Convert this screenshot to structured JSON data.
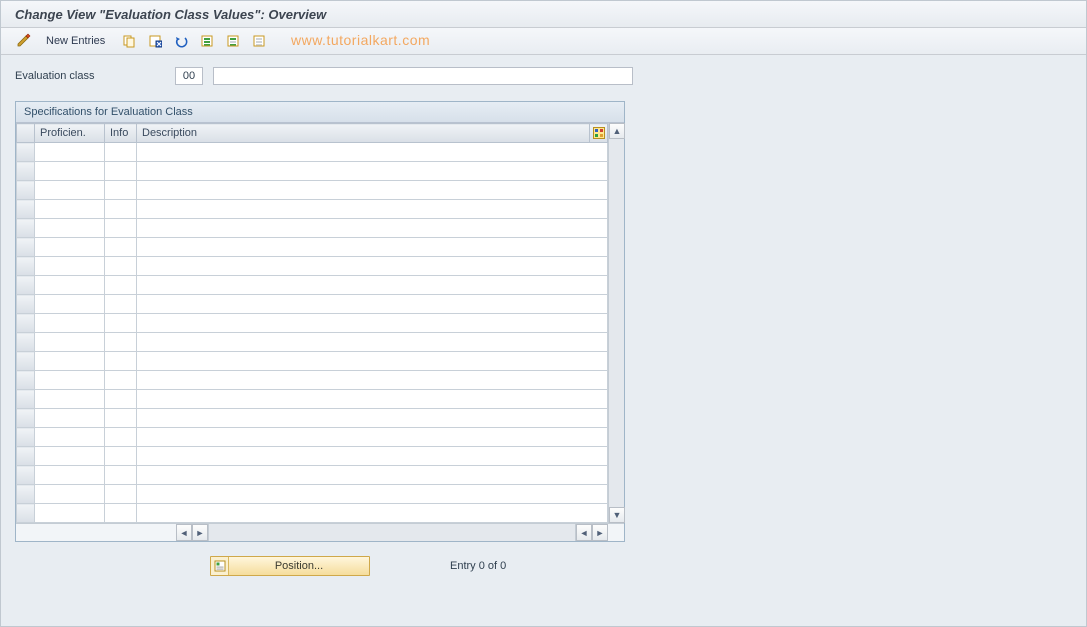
{
  "title": "Change View \"Evaluation Class Values\": Overview",
  "toolbar": {
    "new_entries_label": "New Entries"
  },
  "watermark": "www.tutorialkart.com",
  "field": {
    "label": "Evaluation class",
    "value": "00",
    "desc": ""
  },
  "panel": {
    "title": "Specifications for Evaluation Class",
    "columns": {
      "proficiency": "Proficien.",
      "info": "Info",
      "description": "Description"
    }
  },
  "footer": {
    "position_label": "Position...",
    "entry_text": "Entry 0 of 0"
  },
  "icons": {
    "edit": "edit-icon",
    "copy": "copy-icon",
    "delete": "delete-icon",
    "undo": "undo-icon",
    "select_all": "select-all-icon",
    "select_block": "select-block-icon",
    "deselect_all": "deselect-all-icon",
    "configure": "configure-icon"
  }
}
